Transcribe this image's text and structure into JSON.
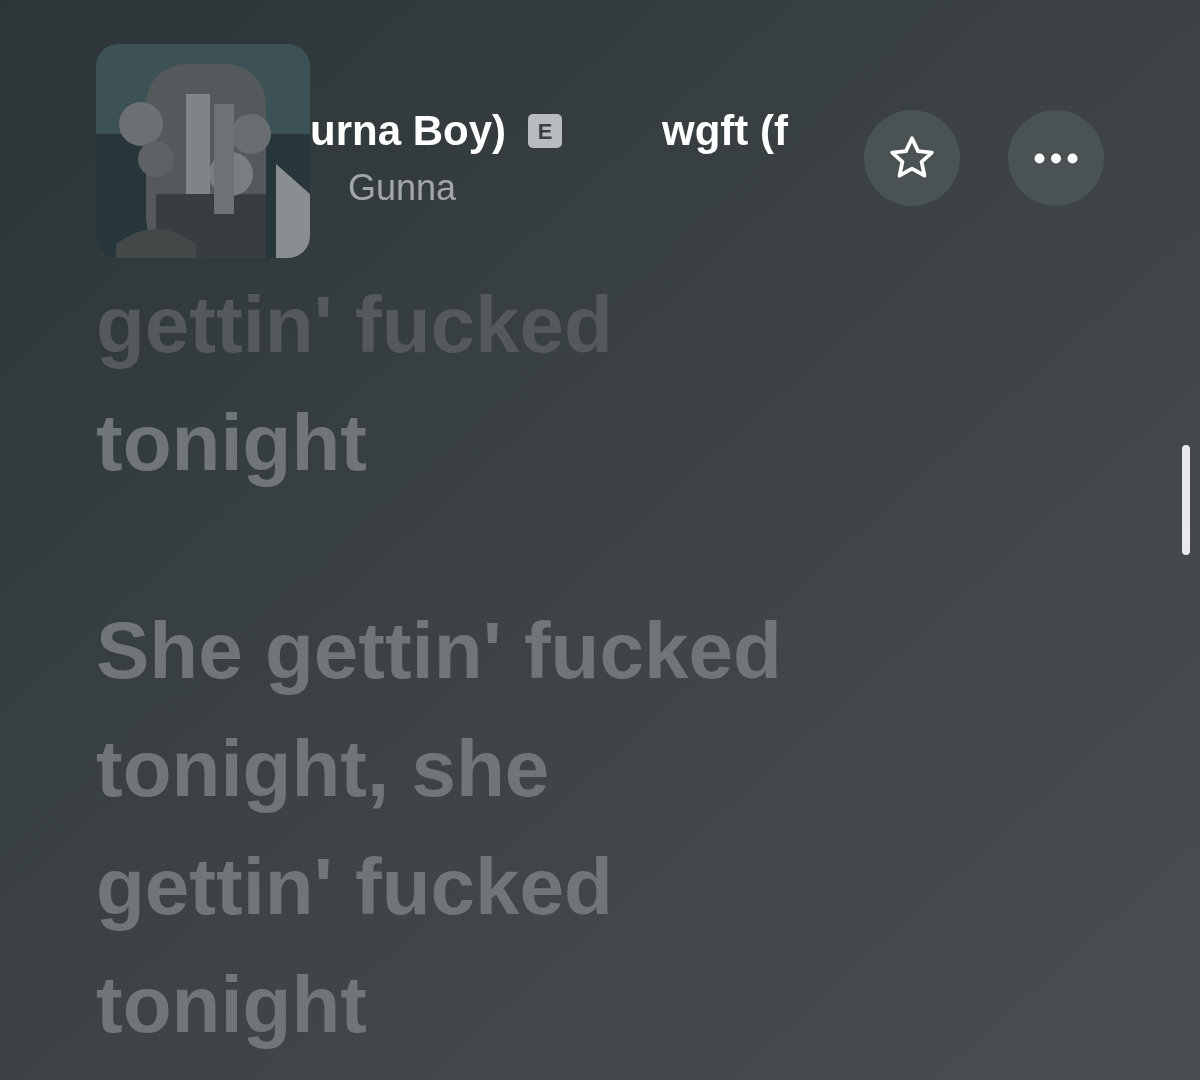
{
  "now_playing": {
    "title_segments": [
      "urna Boy)",
      "wgft (f"
    ],
    "explicit_badge": "E",
    "artist": "Gunna",
    "favorite": false
  },
  "lyrics": [
    {
      "lines": [
        "gettin' fucked",
        "tonight"
      ],
      "selected": false,
      "faded_top": true
    },
    {
      "lines": [
        "She gettin' fucked",
        "tonight, she",
        "gettin' fucked",
        "tonight"
      ],
      "selected": false,
      "faded_top": false
    }
  ]
}
